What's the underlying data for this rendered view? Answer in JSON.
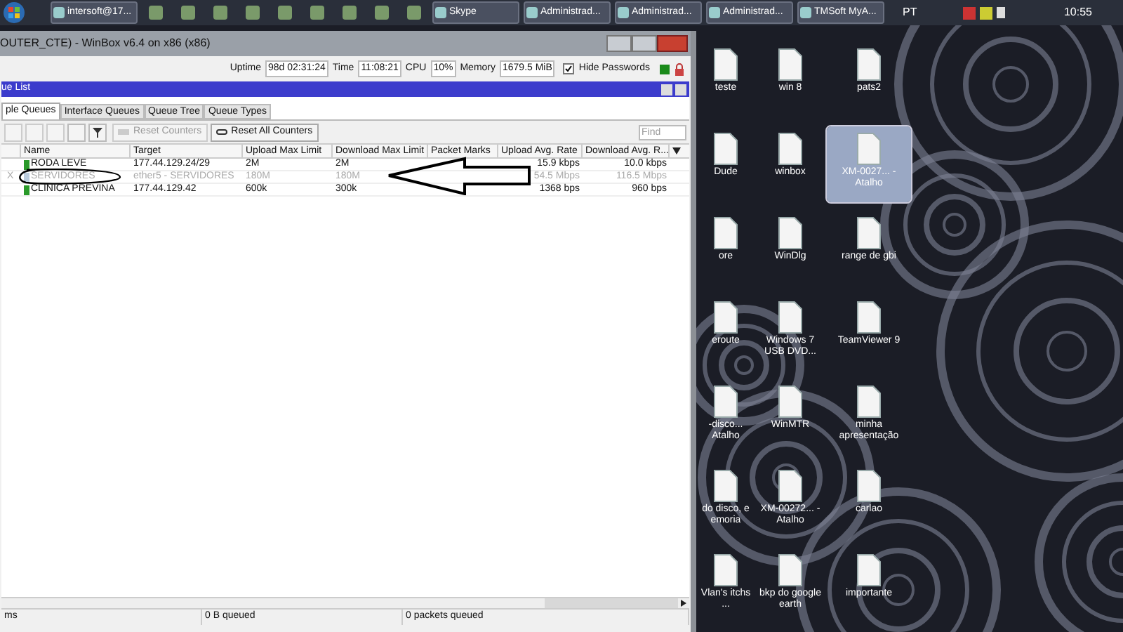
{
  "taskbar": {
    "buttons": [
      {
        "label": "intersoft@17...",
        "kind": "window"
      },
      {
        "kind": "icon"
      },
      {
        "kind": "icon"
      },
      {
        "kind": "icon"
      },
      {
        "kind": "icon"
      },
      {
        "kind": "icon"
      },
      {
        "kind": "icon"
      },
      {
        "kind": "icon"
      },
      {
        "kind": "icon"
      },
      {
        "kind": "icon"
      },
      {
        "label": "Skype",
        "kind": "window"
      },
      {
        "label": "Administrad...",
        "kind": "window"
      },
      {
        "label": "Administrad...",
        "kind": "window"
      },
      {
        "label": "Administrad...",
        "kind": "window"
      },
      {
        "label": "TMSoft MyA...",
        "kind": "window"
      }
    ],
    "language": "PT",
    "clock": "10:55"
  },
  "winbox": {
    "title": "OUTER_CTE) - WinBox v6.4 on x86 (x86)",
    "status": [
      {
        "label": "Uptime",
        "value": "98d 02:31:24"
      },
      {
        "label": "Time",
        "value": "11:08:21"
      },
      {
        "label": "CPU",
        "value": "10%"
      },
      {
        "label": "Memory",
        "value": "1679.5 MiB"
      }
    ],
    "hide_passwords": {
      "label": "Hide Passwords",
      "checked": true
    },
    "panel": {
      "title": "ue List",
      "tabs": [
        {
          "label": "ple Queues",
          "selected": true
        },
        {
          "label": "Interface Queues",
          "selected": false
        },
        {
          "label": "Queue Tree",
          "selected": false
        },
        {
          "label": "Queue Types",
          "selected": false
        }
      ],
      "toolbar": [
        {
          "label": "Reset Counters",
          "disabled": true
        },
        {
          "label": "Reset All Counters",
          "disabled": false
        }
      ],
      "find": {
        "placeholder": "Find"
      },
      "columns": [
        "Name",
        "Target",
        "Upload Max Limit",
        "Download Max Limit",
        "Packet Marks",
        "Upload Avg. Rate",
        "Download Avg. R..."
      ],
      "rows": [
        {
          "disabled": false,
          "cells": [
            "RODA LEVE",
            "177.44.129.24/29",
            "2M",
            "2M",
            "",
            "15.9 kbps",
            "10.0 kbps"
          ]
        },
        {
          "disabled": true,
          "flag": "X",
          "cells": [
            "SERVIDORES",
            "ether5 - SERVIDORES",
            "180M",
            "180M",
            "",
            "54.5 Mbps",
            "116.5 Mbps"
          ]
        },
        {
          "disabled": false,
          "cells": [
            "CLINICA PREVINA",
            "177.44.129.42",
            "600k",
            "300k",
            "",
            "1368 bps",
            "960 bps"
          ]
        }
      ],
      "status_bar": [
        "ms",
        "0 B queued",
        "0 packets queued"
      ]
    }
  },
  "desktop": {
    "icons": [
      {
        "label": "teste",
        "selected": false
      },
      {
        "label": "win 8",
        "selected": false
      },
      {
        "label": "pats2",
        "selected": false
      },
      {
        "label": "Dude",
        "selected": false
      },
      {
        "label": "winbox",
        "selected": false
      },
      {
        "label": "XM-0027... - Atalho",
        "selected": true
      },
      {
        "label": "ore",
        "selected": false
      },
      {
        "label": "WinDlg",
        "selected": false
      },
      {
        "label": "range de gbi",
        "selected": false
      },
      {
        "label": "eroute",
        "selected": false
      },
      {
        "label": "Windows 7 USB DVD...",
        "selected": false
      },
      {
        "label": "TeamViewer 9",
        "selected": false
      },
      {
        "label": "-disco... Atalho",
        "selected": false
      },
      {
        "label": "WinMTR",
        "selected": false
      },
      {
        "label": "minha apresentação",
        "selected": false
      },
      {
        "label": "do disco, e emoria",
        "selected": false
      },
      {
        "label": "XM-00272... - Atalho",
        "selected": false
      },
      {
        "label": "carlao",
        "selected": false
      },
      {
        "label": "Vlan's itchs ...",
        "selected": false
      },
      {
        "label": "bkp do google earth",
        "selected": false
      },
      {
        "label": "importante",
        "selected": false
      }
    ]
  }
}
